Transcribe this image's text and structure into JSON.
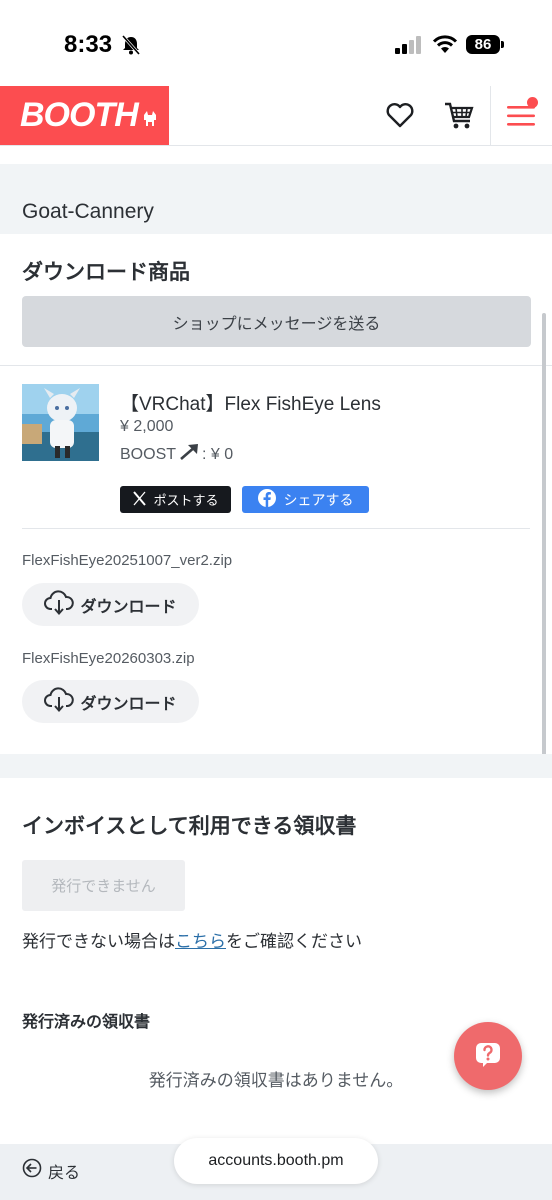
{
  "status_bar": {
    "time": "8:33",
    "battery": "86"
  },
  "header": {
    "logo_text": "BOOTH"
  },
  "shop": {
    "name": "Goat-Cannery"
  },
  "downloads": {
    "title": "ダウンロード商品",
    "message_button": "ショップにメッセージを送る",
    "item": {
      "title": "【VRChat】Flex FishEye Lens",
      "price": "¥ 2,000",
      "boost_label": "BOOST",
      "boost_value": ": ¥ 0"
    },
    "post_button": "ポストする",
    "share_button": "シェアする",
    "files": [
      {
        "name": "FlexFishEye20251007_ver2.zip",
        "button": "ダウンロード"
      },
      {
        "name": "FlexFishEye20260303.zip",
        "button": "ダウンロード"
      }
    ]
  },
  "invoice": {
    "title": "インボイスとして利用できる領収書",
    "issue_button": "発行できません",
    "help_prefix": "発行できない場合は",
    "help_link": "こちら",
    "help_suffix": "をご確認ください",
    "issued_title": "発行済みの領収書",
    "issued_empty": "発行済みの領収書はありません。"
  },
  "bottom_bar": {
    "back_label": "戻る",
    "url": "accounts.booth.pm"
  },
  "colors": {
    "brand": "#fc4d50",
    "share_blue": "#3b82f1",
    "post_black": "#16191e",
    "fab": "#ef6a6c"
  },
  "icons": [
    "bell-slash-icon",
    "signal-icon",
    "wifi-icon",
    "heart-icon",
    "cart-icon",
    "menu-icon",
    "x-logo-icon",
    "facebook-icon",
    "cloud-download-icon",
    "help-icon",
    "back-arrow-icon"
  ]
}
